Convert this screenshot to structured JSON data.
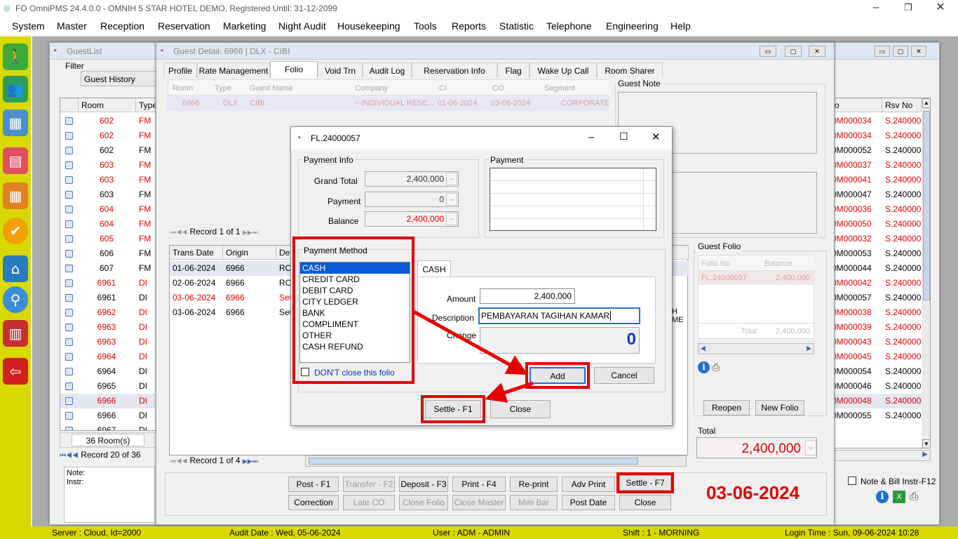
{
  "app": {
    "title": "FO OmniPMS 24.4.0.0 - OMNIH 5 STAR HOTEL DEMO, Registered Until: 31-12-2099"
  },
  "menu": [
    "System",
    "Master",
    "Reception",
    "Reservation",
    "Marketing",
    "Night Audit",
    "Housekeeping",
    "Tools",
    "Reports",
    "Statistic",
    "Telephone",
    "Engineering",
    "Help"
  ],
  "guestlist": {
    "title": "GuestList",
    "filter_label": "Filter",
    "filter_value": "Guest History",
    "columns": [
      "Room",
      "Type"
    ],
    "rows": [
      {
        "room": "602",
        "type": "FM",
        "red": true
      },
      {
        "room": "602",
        "type": "FM",
        "red": true
      },
      {
        "room": "602",
        "type": "FM",
        "red": false
      },
      {
        "room": "603",
        "type": "FM",
        "red": true
      },
      {
        "room": "603",
        "type": "FM",
        "red": true
      },
      {
        "room": "603",
        "type": "FM",
        "red": false
      },
      {
        "room": "604",
        "type": "FM",
        "red": true
      },
      {
        "room": "604",
        "type": "FM",
        "red": true
      },
      {
        "room": "605",
        "type": "FM",
        "red": true
      },
      {
        "room": "606",
        "type": "FM",
        "red": false
      },
      {
        "room": "607",
        "type": "FM",
        "red": false
      },
      {
        "room": "6961",
        "type": "DI",
        "red": true
      },
      {
        "room": "6961",
        "type": "DI",
        "red": false
      },
      {
        "room": "6962",
        "type": "DI",
        "red": true
      },
      {
        "room": "6963",
        "type": "DI",
        "red": true
      },
      {
        "room": "6963",
        "type": "DI",
        "red": true
      },
      {
        "room": "6964",
        "type": "DI",
        "red": true
      },
      {
        "room": "6964",
        "type": "DI",
        "red": false
      },
      {
        "room": "6965",
        "type": "DI",
        "red": false
      },
      {
        "room": "6966",
        "type": "DI",
        "red": true
      },
      {
        "room": "6966",
        "type": "DI",
        "red": false
      },
      {
        "room": "6967",
        "type": "DI",
        "red": false
      }
    ],
    "room_count": "36 Room(s)",
    "record": "Record 20 of 36",
    "note_label": "Note:",
    "instr_label": "Instr:"
  },
  "right_list": {
    "col_rsv": "Rsv No",
    "col_o": "o",
    "rows": [
      {
        "o": "0M000034",
        "rsv": "S.240000",
        "red": true
      },
      {
        "o": "0M000034",
        "rsv": "S.240000",
        "red": true
      },
      {
        "o": "0M000052",
        "rsv": "S.240000",
        "red": false
      },
      {
        "o": "0M000037",
        "rsv": "S.240000",
        "red": true
      },
      {
        "o": "0M000041",
        "rsv": "S.240000",
        "red": true
      },
      {
        "o": "0M000047",
        "rsv": "S.240000",
        "red": false
      },
      {
        "o": "0M000036",
        "rsv": "S.240000",
        "red": true
      },
      {
        "o": "0M000050",
        "rsv": "S.240000",
        "red": true
      },
      {
        "o": "0M000032",
        "rsv": "S.240000",
        "red": true
      },
      {
        "o": "0M000053",
        "rsv": "S.240000",
        "red": false
      },
      {
        "o": "0M000044",
        "rsv": "S.240000",
        "red": false
      },
      {
        "o": "0M000042",
        "rsv": "S.240000",
        "red": true
      },
      {
        "o": "0M000057",
        "rsv": "S.240000",
        "red": false
      },
      {
        "o": "0M000038",
        "rsv": "S.240000",
        "red": true
      },
      {
        "o": "0M000039",
        "rsv": "S.240000",
        "red": true
      },
      {
        "o": "0M000043",
        "rsv": "S.240000",
        "red": true
      },
      {
        "o": "0M000045",
        "rsv": "S.240000",
        "red": true
      },
      {
        "o": "0M000054",
        "rsv": "S.240000",
        "red": false
      },
      {
        "o": "0M000046",
        "rsv": "S.240000",
        "red": false
      },
      {
        "o": "0M000048",
        "rsv": "S.240000",
        "red": true
      },
      {
        "o": "0M000055",
        "rsv": "S.240000",
        "red": false
      }
    ],
    "note_bill_label": "Note & Bill Instr-F12"
  },
  "guest_detail": {
    "title": "Guest Detail. 6966 | DLX - CIBI",
    "tabs": [
      "Profile",
      "Rate Management",
      "Folio",
      "Void Trn",
      "Audit Log",
      "Reservation Info",
      "Flag",
      "Wake Up Call",
      "Room Sharer"
    ],
    "info_cols": [
      "Room",
      "Type",
      "Guest Name",
      "Company",
      "CI",
      "CO",
      "Segment"
    ],
    "info_row": [
      "6966",
      "DLX",
      "CIBI",
      "~ INDIVIDUAL RESE...",
      "01-06-2024",
      "03-06-2024",
      "CORPORATE"
    ],
    "guest_note_label": "Guest Note",
    "record_top": "Record 1 of 1",
    "trans_cols": [
      "Trans Date",
      "Origin",
      "Des"
    ],
    "trans_rows": [
      {
        "date": "01-06-2024",
        "origin": "6966",
        "des": "ROO",
        "red": false
      },
      {
        "date": "02-06-2024",
        "origin": "6966",
        "des": "ROO",
        "red": false
      },
      {
        "date": "03-06-2024",
        "origin": "6966",
        "des": "Settl",
        "red": true
      },
      {
        "date": "03-06-2024",
        "origin": "6966",
        "des": "Settl",
        "red": false
      }
    ],
    "record_bottom": "Record 1 of 4",
    "guest_folio_label": "Guest Folio",
    "folio_cols": [
      "Folio No",
      "Balance"
    ],
    "folio_row": [
      "FL.24000057",
      "2,400,000"
    ],
    "folio_total_label": "Total",
    "folio_total_value": "2,400,000",
    "reopen": "Reopen",
    "new_folio": "New Folio",
    "total_label": "Total",
    "total_value": "2,400,000",
    "buttons_row1": [
      "Post - F1",
      "Transfer - F2",
      "Deposit - F3",
      "Print - F4",
      "Re-print",
      "Adv Print",
      "Settle - F7"
    ],
    "buttons_row2": [
      "Correction",
      "Late CO",
      "Close Folio",
      "Close Master",
      "Mini Bar",
      "Post Date",
      "Close"
    ],
    "date_big": "03-06-2024",
    "partial_text": "H ME"
  },
  "dialog": {
    "title": "FL.24000057",
    "payment_info_label": "Payment Info",
    "grand_total_label": "Grand Total",
    "grand_total_value": "2,400,000",
    "payment_label": "Payment",
    "payment_value": "0",
    "balance_label": "Balance",
    "balance_value": "2,400,000",
    "payment_group_label": "Payment",
    "method_label": "Payment Method",
    "methods": [
      "CASH",
      "CREDIT CARD",
      "DEBIT CARD",
      "CITY LEDGER",
      "BANK",
      "COMPLIMENT",
      "OTHER",
      "CASH REFUND"
    ],
    "dont_close": "DON'T close this folio",
    "tab_cash": "CASH",
    "amount_label": "Amount",
    "amount_value": "2,400,000",
    "description_label": "Description",
    "description_value": "PEMBAYARAN TAGIHAN KAMAR",
    "change_label": "Change",
    "change_value": "0",
    "add": "Add",
    "cancel": "Cancel",
    "settle": "Settle - F1",
    "close": "Close"
  },
  "status": {
    "server": "Server : Cloud, Id=2000",
    "audit": "Audit Date : Wed, 05-06-2024",
    "user": "User : ADM - ADMIN",
    "shift": "Shift : 1 - MORNING",
    "login": "Login Time : Sun, 09-06-2024 10:28"
  },
  "colors": {
    "highlight": "#e50000",
    "statusbar": "#d9d900",
    "accent_blue": "#0a3cc8"
  }
}
